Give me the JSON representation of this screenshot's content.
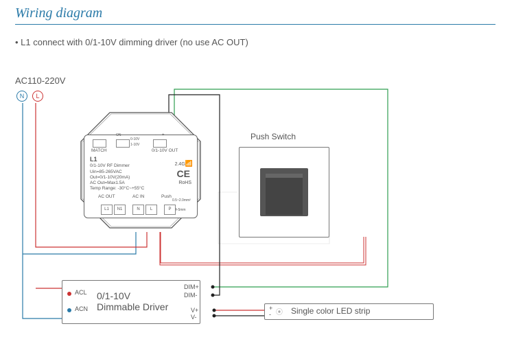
{
  "title": "Wiring diagram",
  "bullet": "L1 connect with 0/1-10V dimming driver (no use AC OUT)",
  "ac_label": "AC110-220V",
  "n_letter": "N",
  "l_letter": "L",
  "push_switch": {
    "label": "Push Switch"
  },
  "driver": {
    "name_line1": "0/1-10V",
    "name_line2": "Dimmable Driver",
    "acl": "ACL",
    "acn": "ACN",
    "dim_plus": "DIM+",
    "dim_minus": "DIM-",
    "v_plus": "V+",
    "v_minus": "V-"
  },
  "strip": {
    "name": "Single color LED strip",
    "plus": "+",
    "minus": "-"
  },
  "l1": {
    "match": "MATCH",
    "sw1_on": "ON",
    "sw1_a": "0-10V",
    "sw1_b": "1-10V",
    "sw2_plus": "+",
    "sw2_minus": "-",
    "out_lbl": "0/1-10V OUT",
    "model": "L1",
    "desc": "0/1-10V  RF Dimmer",
    "uin": "Uin=85-265VAC",
    "out": "Out=0/1-10V(20mA)",
    "acout": "AC Out=Max1.5A",
    "temp": "Temp Range: -30°C~+55°C",
    "ac_out_lbl": "AC OUT",
    "ac_in_lbl": "AC IN",
    "push_lbl": "Push",
    "wire": "0.5~2.0mm²",
    "strip": "4-5mm",
    "ce": "CE",
    "rohs": "RoHS",
    "g24": "2.4G",
    "terms": [
      "L1",
      "N1",
      "N",
      "L",
      "P"
    ]
  }
}
